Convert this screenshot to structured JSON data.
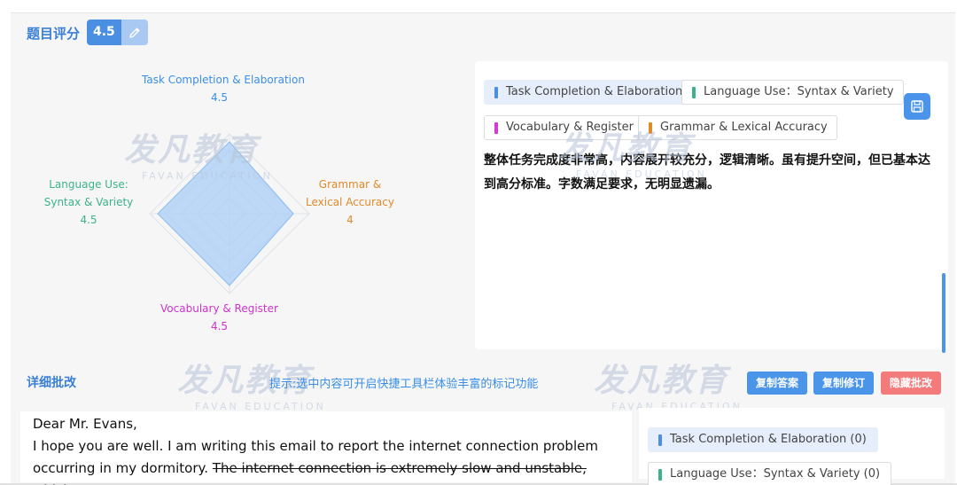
{
  "header": {
    "title": "题目评分",
    "score": "4.5",
    "edit_icon": "pencil-icon"
  },
  "radar": {
    "axes": [
      {
        "key": "task",
        "line1": "Task Completion & Elaboration",
        "line2": "",
        "score": "4.5",
        "value": 4.5,
        "color": "#3a8ee6"
      },
      {
        "key": "gram",
        "line1": "Grammar &",
        "line2": "Lexical Accuracy",
        "score": "4",
        "value": 4,
        "color": "#e28a2a"
      },
      {
        "key": "vocab",
        "line1": "Vocabulary & Register",
        "line2": "",
        "score": "4.5",
        "value": 4.5,
        "color": "#cc33cc"
      },
      {
        "key": "lang",
        "line1": "Language Use:",
        "line2": "Syntax & Variety",
        "score": "4.5",
        "value": 4.5,
        "color": "#3bb38b"
      }
    ],
    "max": 5
  },
  "comment": {
    "tags": [
      {
        "label": "Task Completion & Elaboration",
        "color": "#4a8fe2",
        "active": true
      },
      {
        "label": "Language Use：Syntax & Variety",
        "color": "#3bb38b",
        "active": false
      },
      {
        "label": "Vocabulary & Register",
        "color": "#d63bd6",
        "active": false
      },
      {
        "label": "Grammar & Lexical Accuracy",
        "color": "#e28a2a",
        "active": false
      }
    ],
    "save_icon": "save-icon",
    "text": "整体任务完成度非常高，内容展开较充分，逻辑清晰。虽有提升空间，但已基本达到高分标准。字数满足要求，无明显遗漏。"
  },
  "detail": {
    "title": "详细批改",
    "hint": "提示:选中内容可开启快捷工具栏体验丰富的标记功能",
    "buttons": {
      "copy_answer": "复制答案",
      "copy_revision": "复制修订",
      "hide_review": "隐藏批改"
    },
    "essay": {
      "line1": "Dear Mr. Evans,",
      "line2": "I hope you are well. I am writing this email to report the internet connection problem",
      "line3_plain": "occurring in my dormitory. ",
      "line3_strike": "The internet connection is extremely slow and unstable, which"
    },
    "side_tags": [
      {
        "label": "Task Completion & Elaboration (0)",
        "color": "#4a8fe2",
        "active": true
      },
      {
        "label": "Language Use：Syntax & Variety (0)",
        "color": "#3bb38b",
        "active": false
      }
    ]
  },
  "watermark": {
    "cn": "发凡教育",
    "en": "FAVAN EDUCATION"
  }
}
